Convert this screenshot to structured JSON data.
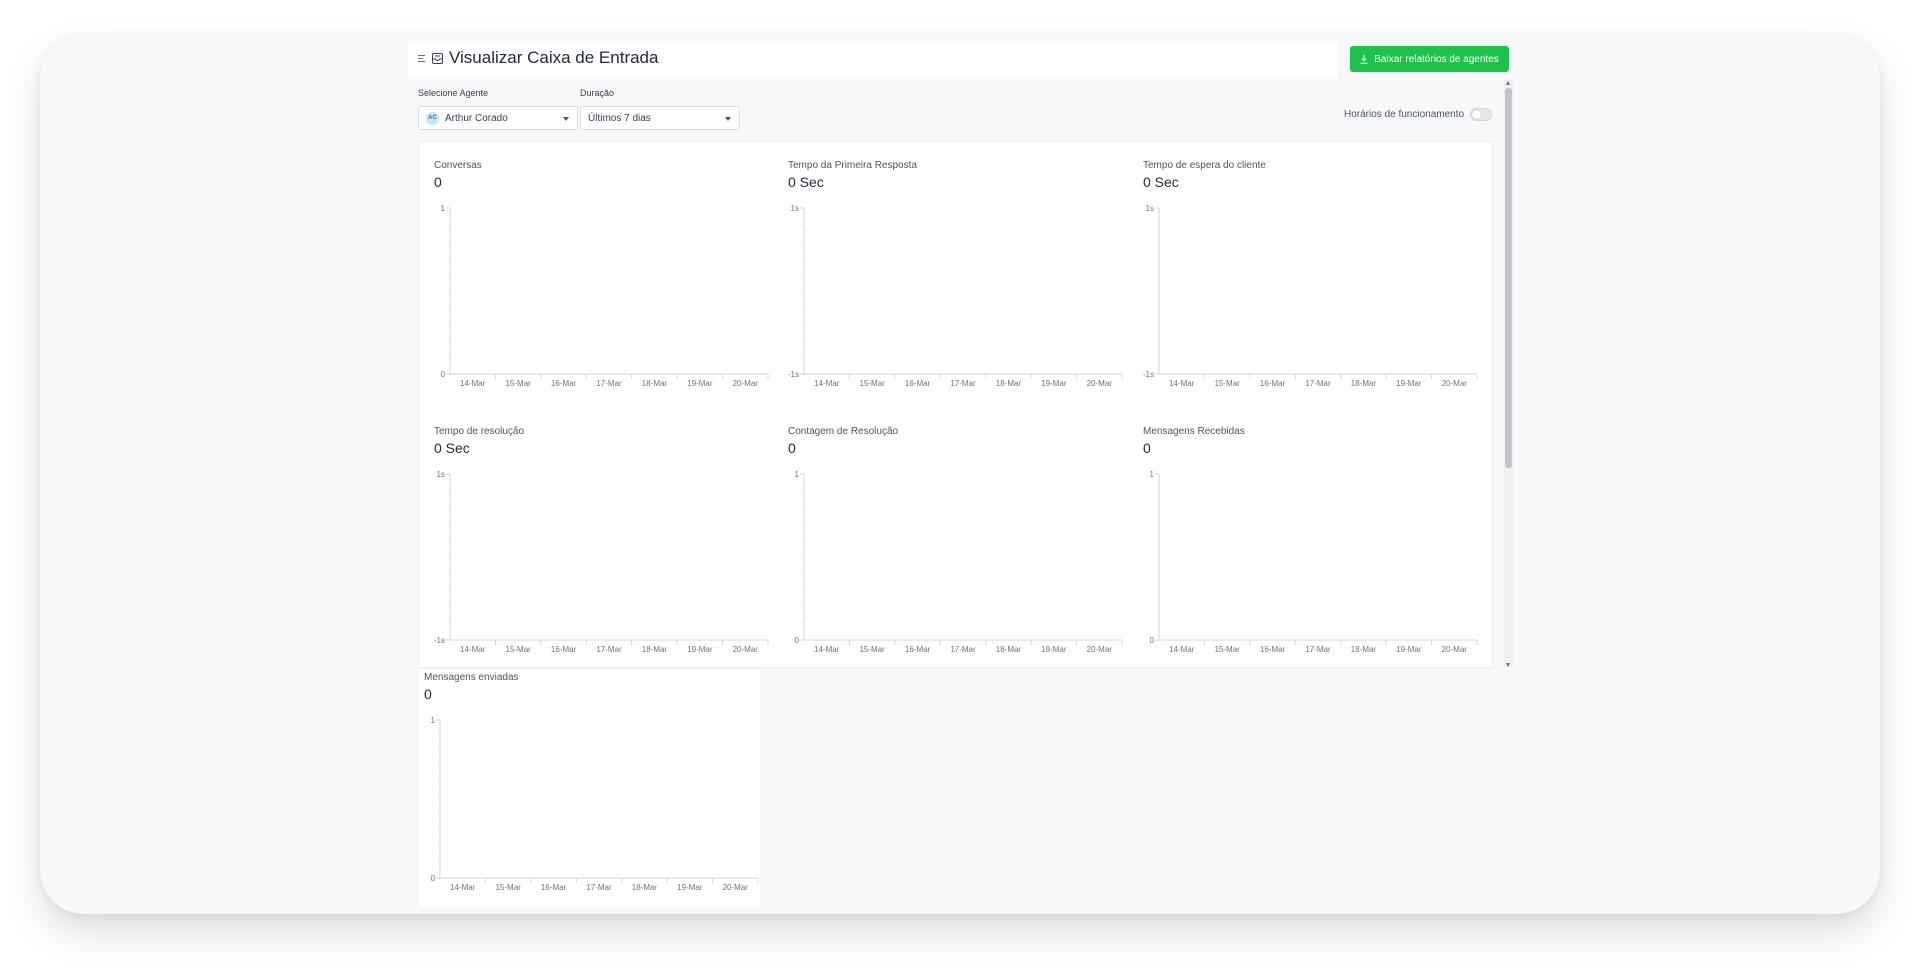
{
  "header": {
    "title": "Visualizar Caixa de Entrada",
    "download_label": "Baixar relatórios de agentes"
  },
  "filters": {
    "agent_label": "Selecione Agente",
    "agent_value": "Arthur Corado",
    "agent_initials": "AC",
    "duration_label": "Duração",
    "duration_value": "Últimos 7 dias"
  },
  "business_hours": {
    "label": "Horários de funcionamento",
    "enabled": false
  },
  "colors": {
    "accent": "#1ec24a",
    "axis": "#d1d5db",
    "text": "#1f2937"
  },
  "icons": {
    "menu": "menu-icon",
    "inbox": "inbox-icon",
    "download": "download-icon"
  },
  "chart_data": [
    {
      "type": "bar",
      "title": "Conversas",
      "value": "0",
      "categories": [
        "14-Mar",
        "15-Mar",
        "16-Mar",
        "17-Mar",
        "18-Mar",
        "19-Mar",
        "20-Mar"
      ],
      "values": [
        0,
        0,
        0,
        0,
        0,
        0,
        0
      ],
      "yticks": [
        "0",
        "1"
      ],
      "ylim": [
        0,
        1
      ]
    },
    {
      "type": "bar",
      "title": "Tempo da Primeira Resposta",
      "value": "0 Sec",
      "categories": [
        "14-Mar",
        "15-Mar",
        "16-Mar",
        "17-Mar",
        "18-Mar",
        "19-Mar",
        "20-Mar"
      ],
      "values": [
        0,
        0,
        0,
        0,
        0,
        0,
        0
      ],
      "yticks": [
        "-1s",
        "1s"
      ],
      "ylim": [
        -1,
        1
      ]
    },
    {
      "type": "bar",
      "title": "Tempo de espera do cliente",
      "value": "0 Sec",
      "categories": [
        "14-Mar",
        "15-Mar",
        "16-Mar",
        "17-Mar",
        "18-Mar",
        "19-Mar",
        "20-Mar"
      ],
      "values": [
        0,
        0,
        0,
        0,
        0,
        0,
        0
      ],
      "yticks": [
        "-1s",
        "1s"
      ],
      "ylim": [
        -1,
        1
      ]
    },
    {
      "type": "bar",
      "title": "Tempo de resolução",
      "value": "0 Sec",
      "categories": [
        "14-Mar",
        "15-Mar",
        "16-Mar",
        "17-Mar",
        "18-Mar",
        "19-Mar",
        "20-Mar"
      ],
      "values": [
        0,
        0,
        0,
        0,
        0,
        0,
        0
      ],
      "yticks": [
        "-1s",
        "1s"
      ],
      "ylim": [
        -1,
        1
      ]
    },
    {
      "type": "bar",
      "title": "Contagem de Resolução",
      "value": "0",
      "categories": [
        "14-Mar",
        "15-Mar",
        "16-Mar",
        "17-Mar",
        "18-Mar",
        "19-Mar",
        "20-Mar"
      ],
      "values": [
        0,
        0,
        0,
        0,
        0,
        0,
        0
      ],
      "yticks": [
        "0",
        "1"
      ],
      "ylim": [
        0,
        1
      ]
    },
    {
      "type": "bar",
      "title": "Mensagens Recebidas",
      "value": "0",
      "categories": [
        "14-Mar",
        "15-Mar",
        "16-Mar",
        "17-Mar",
        "18-Mar",
        "19-Mar",
        "20-Mar"
      ],
      "values": [
        0,
        0,
        0,
        0,
        0,
        0,
        0
      ],
      "yticks": [
        "0",
        "1"
      ],
      "ylim": [
        0,
        1
      ]
    },
    {
      "type": "bar",
      "title": "Mensagens enviadas",
      "value": "0",
      "categories": [
        "14-Mar",
        "15-Mar",
        "16-Mar",
        "17-Mar",
        "18-Mar",
        "19-Mar",
        "20-Mar"
      ],
      "values": [
        0,
        0,
        0,
        0,
        0,
        0,
        0
      ],
      "yticks": [
        "0",
        "1"
      ],
      "ylim": [
        0,
        1
      ]
    }
  ]
}
